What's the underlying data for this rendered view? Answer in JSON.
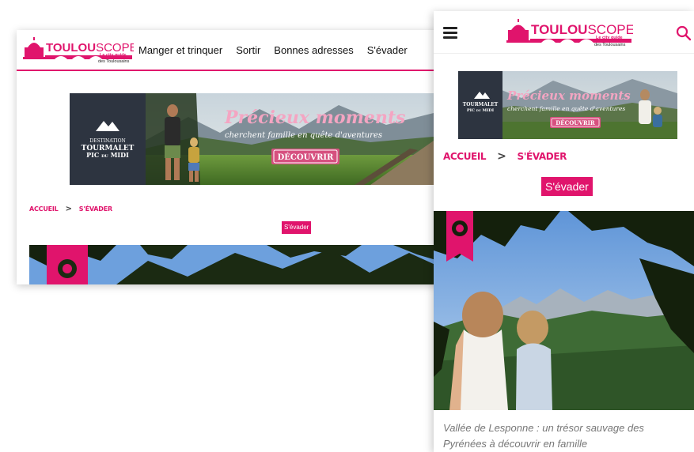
{
  "brand": {
    "name_bold": "TOULOU",
    "name_light": "SCOPE",
    "tagline_bold": "Le city guide",
    "tagline": "des Toulousains",
    "color": "#e0146c"
  },
  "desktop": {
    "nav": [
      "Manger et trinquer",
      "Sortir",
      "Bonnes adresses",
      "S'évader"
    ],
    "breadcrumb": {
      "home": "ACCUEIL",
      "separator": ">",
      "current": "S'ÉVADER"
    },
    "category_tag": "S'évader"
  },
  "banner": {
    "headline": "Précieux moments",
    "subline": "cherchent famille en quête d'aventures",
    "cta": "DÉCOUVRIR",
    "destination_label": "DESTINATION",
    "destination_name": "TOURMALET",
    "destination_sub1": "PIC",
    "destination_sub_small": "DU",
    "destination_sub2": "MIDI"
  },
  "mobile": {
    "menu_icon": "hamburger-icon",
    "search_icon": "search-icon",
    "breadcrumb": {
      "home": "ACCUEIL",
      "separator": ">",
      "current": "S'ÉVADER"
    },
    "category_tag": "S'évader",
    "article_caption": "Vallée de Lesponne : un trésor sauvage des Pyrénées à découvrir en famille"
  }
}
